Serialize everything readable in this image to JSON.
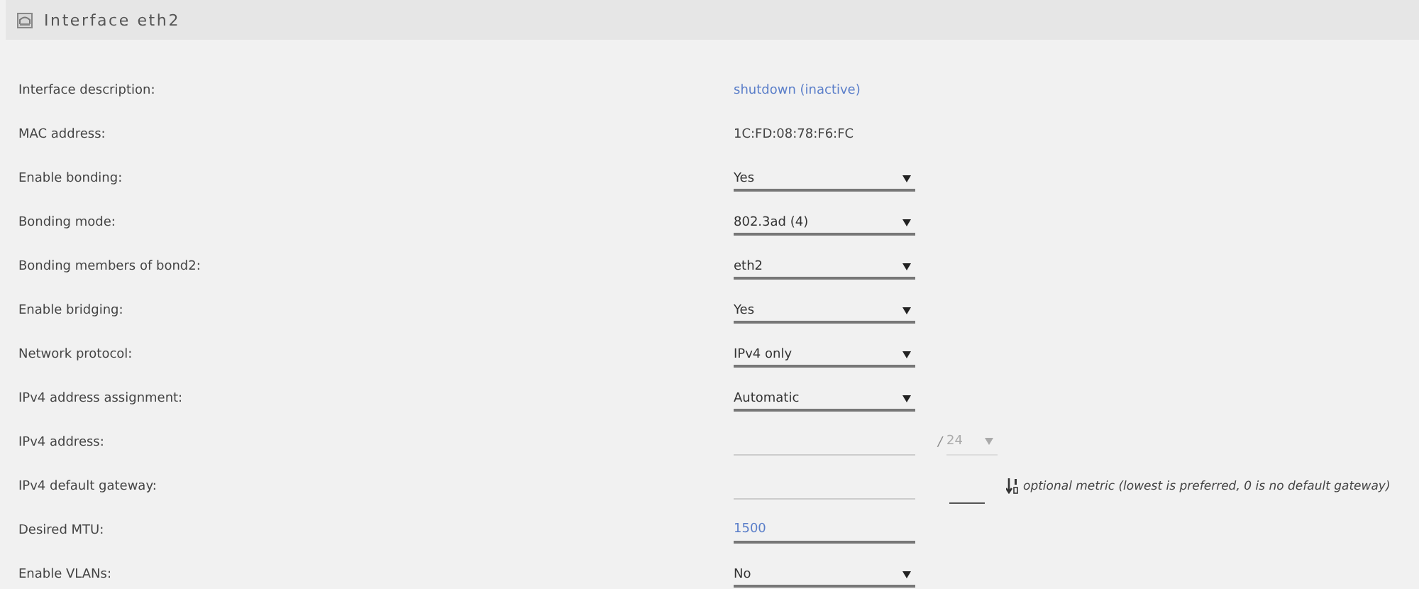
{
  "panel": {
    "title": "Interface eth2"
  },
  "rows": [
    {
      "label": "Interface description:",
      "kind": "link",
      "value": "shutdown (inactive)"
    },
    {
      "label": "MAC address:",
      "kind": "text",
      "value": "1C:FD:08:78:F6:FC"
    },
    {
      "label": "Enable bonding:",
      "kind": "select",
      "value": "Yes"
    },
    {
      "label": "Bonding mode:",
      "kind": "select",
      "value": "802.3ad (4)"
    },
    {
      "label": "Bonding members of bond2:",
      "kind": "select",
      "value": "eth2"
    },
    {
      "label": "Enable bridging:",
      "kind": "select",
      "value": "Yes"
    },
    {
      "label": "Network protocol:",
      "kind": "select",
      "value": "IPv4 only"
    },
    {
      "label": "IPv4 address assignment:",
      "kind": "select",
      "value": "Automatic"
    },
    {
      "label": "IPv4 address:",
      "kind": "address",
      "separator": "/",
      "prefix": {
        "value": "24",
        "disabled": true
      }
    },
    {
      "label": "IPv4 default gateway:",
      "kind": "gateway",
      "hint": "optional metric (lowest is preferred, 0 is no default gateway)"
    },
    {
      "label": "Desired MTU:",
      "kind": "input",
      "value": "1500"
    },
    {
      "label": "Enable VLANs:",
      "kind": "select",
      "value": "No"
    }
  ]
}
